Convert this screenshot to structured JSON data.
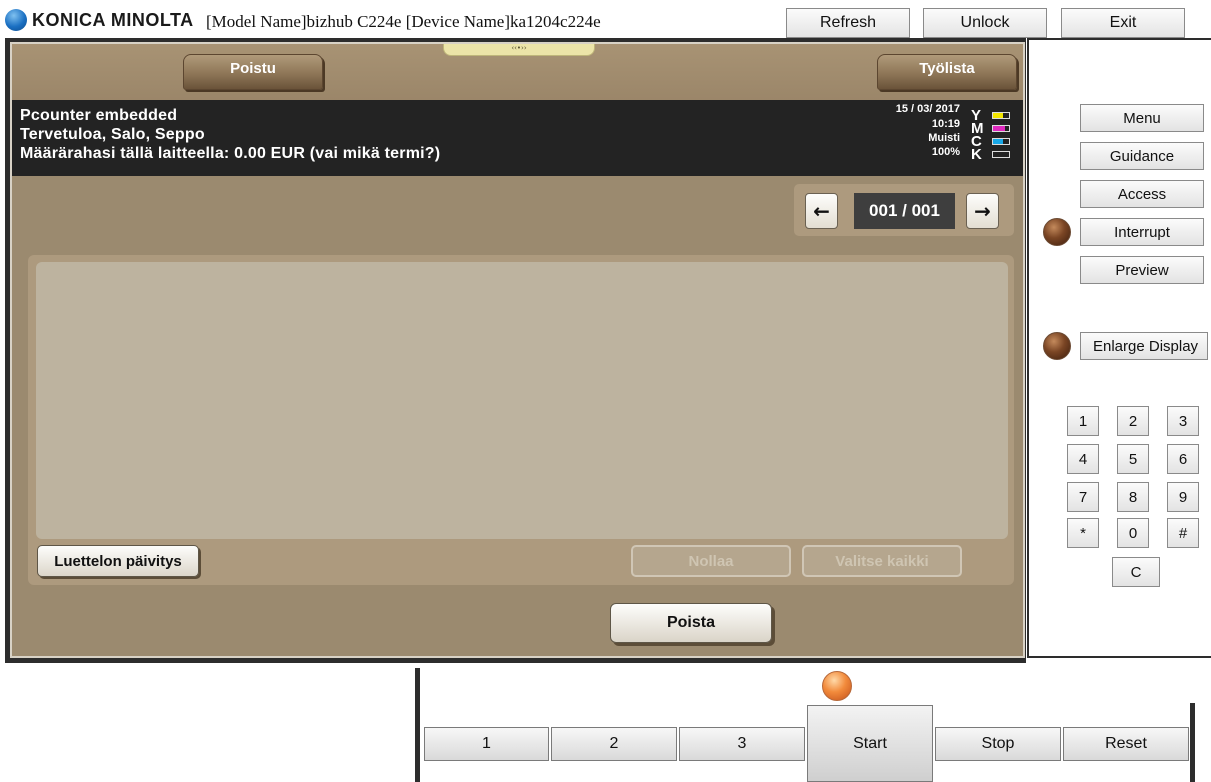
{
  "header": {
    "brand": "KONICA MINOLTA",
    "model_info": "[Model Name]bizhub C224e [Device Name]ka1204c224e",
    "buttons": {
      "refresh": "Refresh",
      "unlock": "Unlock",
      "exit": "Exit"
    }
  },
  "screen": {
    "tabs": {
      "left": "Poistu",
      "right": "Työlista"
    },
    "info": {
      "line1": "Pcounter embedded",
      "line2": "Tervetuloa, Salo, Seppo",
      "line3": "Määrärahasi tällä laitteella: 0.00 EUR (vai mikä termi?)"
    },
    "status": {
      "date": "15 / 03/ 2017",
      "time": "10:19",
      "memory_label": "Muisti",
      "memory_value": "100%",
      "toner": [
        {
          "letter": "Y",
          "color": "#f3e600"
        },
        {
          "letter": "M",
          "color": "#e02ac0"
        },
        {
          "letter": "C",
          "color": "#18a8e8"
        },
        {
          "letter": "K",
          "color": "#222222"
        }
      ]
    },
    "pager": {
      "prev_icon": "←",
      "next_icon": "→",
      "counter": "001 / 001"
    },
    "list": {
      "refresh_label": "Luettelon päivitys",
      "reset_label": "Nollaa",
      "select_all_label": "Valitse kaikki"
    },
    "delete_label": "Poista"
  },
  "side": {
    "menu": "Menu",
    "guidance": "Guidance",
    "access": "Access",
    "interrupt": "Interrupt",
    "preview": "Preview",
    "enlarge_display": "Enlarge Display",
    "keypad": [
      "1",
      "2",
      "3",
      "4",
      "5",
      "6",
      "7",
      "8",
      "9",
      "*",
      "0",
      "#"
    ],
    "clear": "C"
  },
  "bottom": {
    "btn1": "1",
    "btn2": "2",
    "btn3": "3",
    "start": "Start",
    "stop": "Stop",
    "reset": "Reset"
  }
}
